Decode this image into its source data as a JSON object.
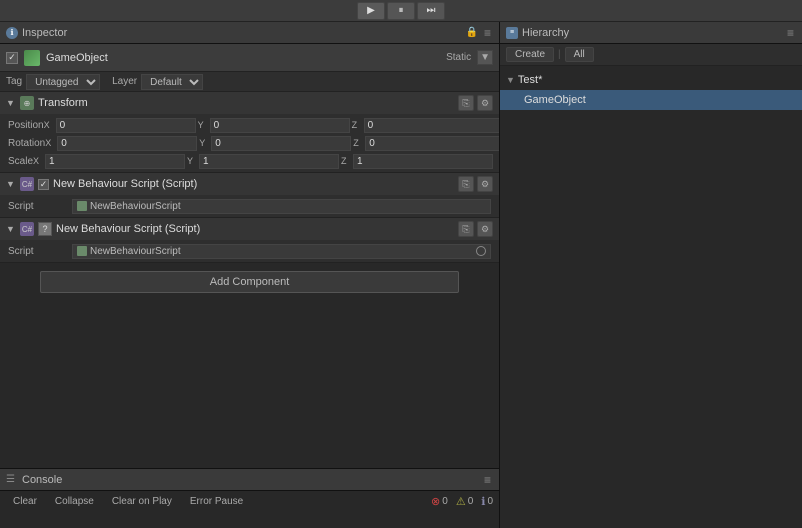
{
  "toolbar": {
    "play_label": "▶",
    "pause_label": "⏸",
    "step_label": "⏭"
  },
  "inspector": {
    "tab_label": "Inspector",
    "gameobject": {
      "name": "GameObject",
      "tag": "Untagged",
      "layer": "Default",
      "static_label": "Static"
    },
    "transform": {
      "name": "Transform",
      "position_label": "Position",
      "rotation_label": "Rotation",
      "scale_label": "Scale",
      "x_label": "X",
      "y_label": "Y",
      "z_label": "Z",
      "position": {
        "x": "0",
        "y": "0",
        "z": "0"
      },
      "rotation": {
        "x": "0",
        "y": "0",
        "z": "0"
      },
      "scale": {
        "x": "1",
        "y": "1",
        "z": "1"
      }
    },
    "script1": {
      "header": "New Behaviour Script (Script)",
      "script_label": "Script",
      "script_name": "NewBehaviourScript"
    },
    "script2": {
      "header": "New Behaviour Script (Script)",
      "script_label": "Script",
      "script_name": "NewBehaviourScript"
    },
    "add_component_label": "Add Component"
  },
  "console": {
    "tab_label": "Console",
    "clear_label": "Clear",
    "collapse_label": "Collapse",
    "clear_on_play_label": "Clear on Play",
    "error_pause_label": "Error Pause",
    "error_count": "0",
    "warn_count": "0",
    "info_count": "0"
  },
  "hierarchy": {
    "tab_label": "Hierarchy",
    "create_label": "Create",
    "all_label": "All",
    "scene_name": "Test*",
    "gameobject_name": "GameObject"
  }
}
